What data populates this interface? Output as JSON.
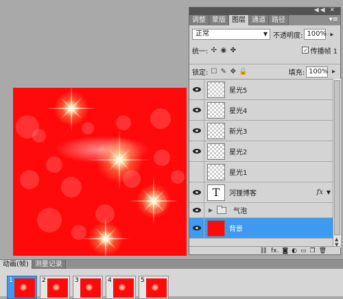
{
  "panel": {
    "tabs": [
      "调整",
      "蒙版",
      "图层",
      "通道",
      "路径"
    ],
    "active_tab": 2,
    "blend_mode": "正常",
    "opacity_label": "不透明度:",
    "opacity_value": "100%",
    "unify_label": "统一:",
    "propagate_label": "传播帧 1",
    "lock_label": "锁定:",
    "fill_label": "填充:",
    "fill_value": "100%"
  },
  "layers": [
    {
      "name": "星光5",
      "visible": true,
      "type": "transparent"
    },
    {
      "name": "星光4",
      "visible": true,
      "type": "transparent"
    },
    {
      "name": "新光3",
      "visible": true,
      "type": "transparent"
    },
    {
      "name": "星光2",
      "visible": true,
      "type": "transparent"
    },
    {
      "name": "星光1",
      "visible": false,
      "type": "transparent"
    },
    {
      "name": "河狸博客",
      "visible": true,
      "type": "text",
      "fx": "fx"
    },
    {
      "name": "气泡",
      "visible": true,
      "type": "group"
    },
    {
      "name": "背景",
      "visible": true,
      "type": "background",
      "selected": true
    }
  ],
  "anim": {
    "tabs": [
      "动画(帧)",
      "测量记录"
    ],
    "frames": [
      "1",
      "2",
      "3",
      "4",
      "5"
    ]
  }
}
